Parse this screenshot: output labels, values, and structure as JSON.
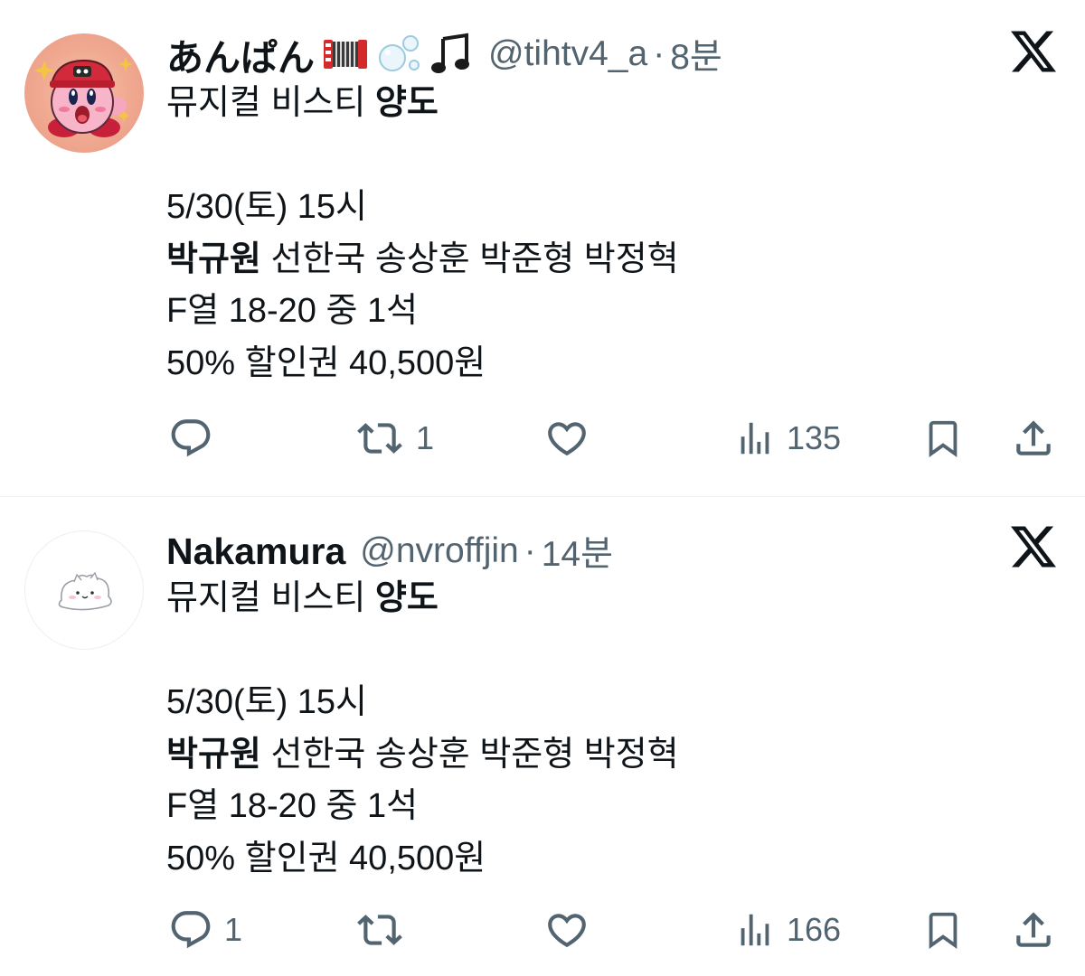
{
  "colors": {
    "text_primary": "#0f1419",
    "text_secondary": "#536471",
    "separator": "#eff3f4",
    "background": "#ffffff"
  },
  "tweets": [
    {
      "display_name": "あんぱん",
      "name_emojis": [
        "accordion-emoji",
        "bubbles-emoji",
        "music-note-emoji"
      ],
      "handle": "@tihtv4_a",
      "separator_dot": "·",
      "time": "8분",
      "avatar": "kirby-avatar",
      "body": {
        "title_normal": "뮤지컬 비스티 ",
        "title_bold": "양도",
        "date_line": "5/30(토) 15시",
        "cast_bold": "박규원",
        "cast_rest": " 선한국 송상훈 박준형 박정혁",
        "seat_line": "F열 18-20 중 1석",
        "price_line": "50% 할인권 40,500원"
      },
      "actions": {
        "reply_count": "",
        "retweet_count": "1",
        "like_count": "",
        "views_count": "135"
      }
    },
    {
      "display_name": "Nakamura",
      "name_emojis": [],
      "handle": "@nvroffjin",
      "separator_dot": "·",
      "time": "14분",
      "avatar": "white-cat-avatar",
      "body": {
        "title_normal": "뮤지컬 비스티 ",
        "title_bold": "양도",
        "date_line": "5/30(토) 15시",
        "cast_bold": "박규원",
        "cast_rest": " 선한국 송상훈 박준형 박정혁",
        "seat_line": "F열 18-20 중 1석",
        "price_line": "50% 할인권 40,500원"
      },
      "actions": {
        "reply_count": "1",
        "retweet_count": "",
        "like_count": "",
        "views_count": "166"
      }
    }
  ]
}
